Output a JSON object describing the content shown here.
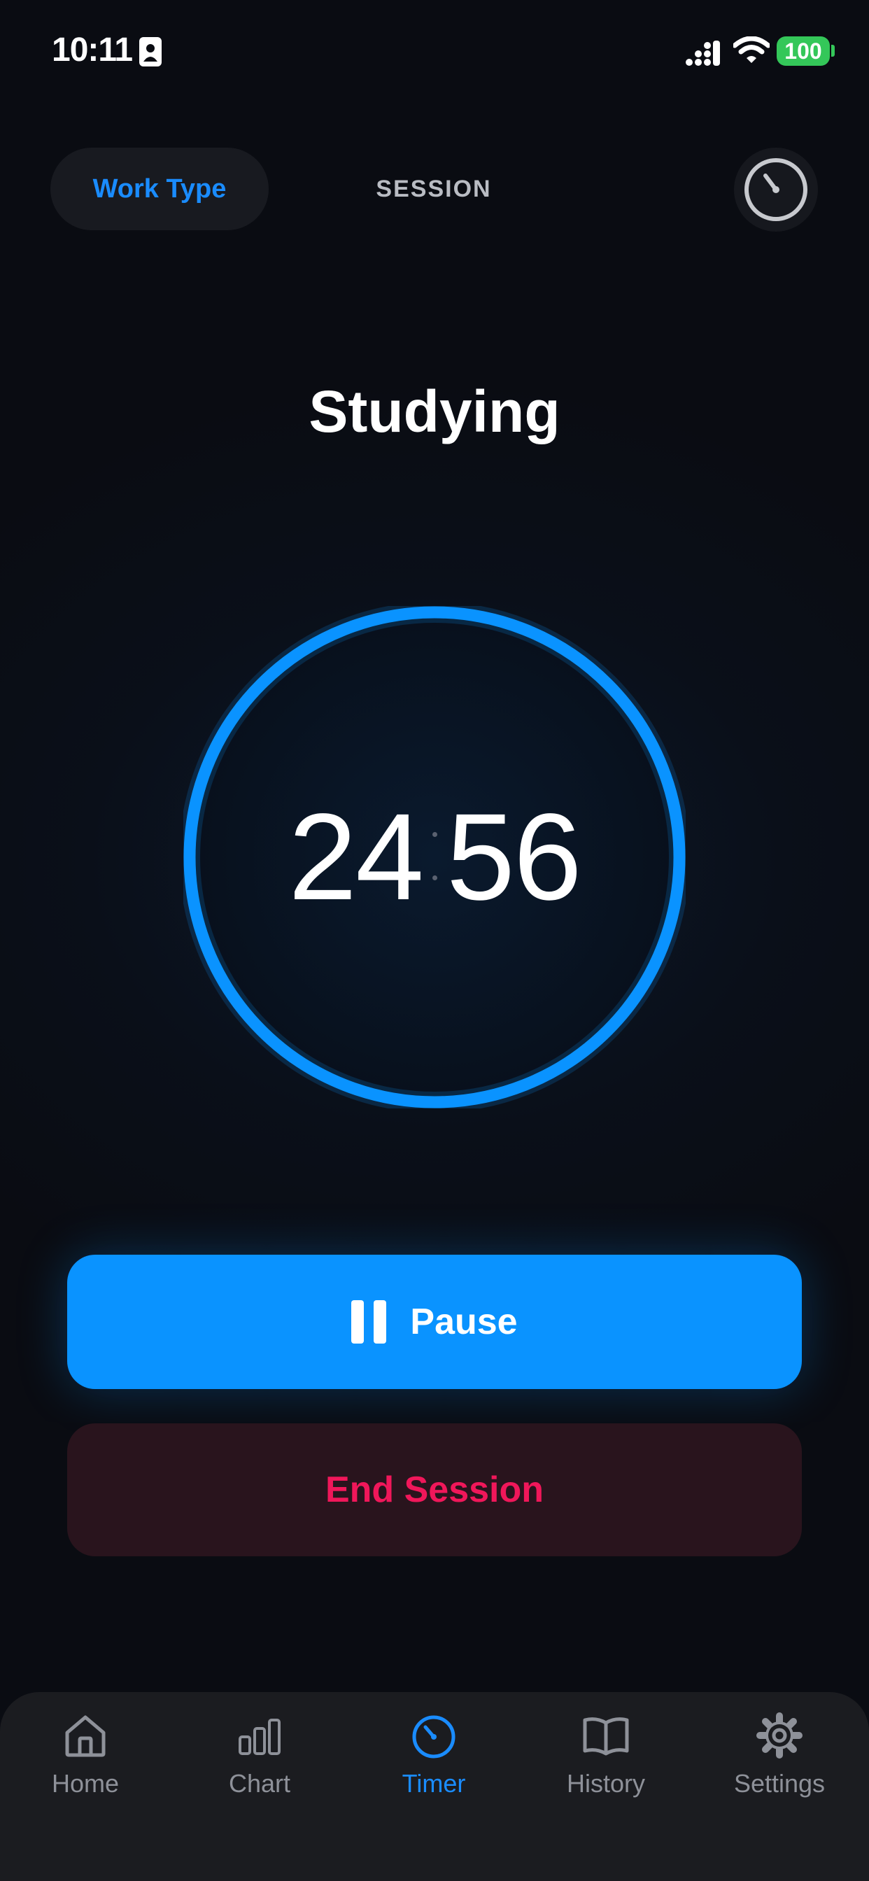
{
  "status_bar": {
    "time": "10:11",
    "battery_level": "100",
    "icons": [
      "contact-card-icon",
      "cellular-signal-icon",
      "wifi-icon",
      "battery-icon"
    ]
  },
  "top_tabs": {
    "work_type_label": "Work Type",
    "session_label": "SESSION",
    "timer_mode_icon": "timer-dial-icon"
  },
  "work_type": {
    "title": "Studying"
  },
  "timer": {
    "minutes": "24",
    "seconds": "56"
  },
  "actions": {
    "pause_label": "Pause",
    "pause_icon": "pause-icon",
    "end_session_label": "End Session"
  },
  "tab_bar": {
    "items": [
      {
        "label": "Home",
        "icon": "house-icon"
      },
      {
        "label": "Chart",
        "icon": "bar-chart-icon"
      },
      {
        "label": "Timer",
        "icon": "timer-icon",
        "active": true
      },
      {
        "label": "History",
        "icon": "book-icon"
      },
      {
        "label": "Settings",
        "icon": "gear-icon"
      }
    ]
  },
  "colors": {
    "accent": "#1a8cff",
    "pause_button": "#0a93ff",
    "ring": "#0a93ff",
    "end_session_text": "#f0175a",
    "end_session_bg": "#29141d",
    "battery": "#34c759",
    "background": "#0a0c12"
  }
}
